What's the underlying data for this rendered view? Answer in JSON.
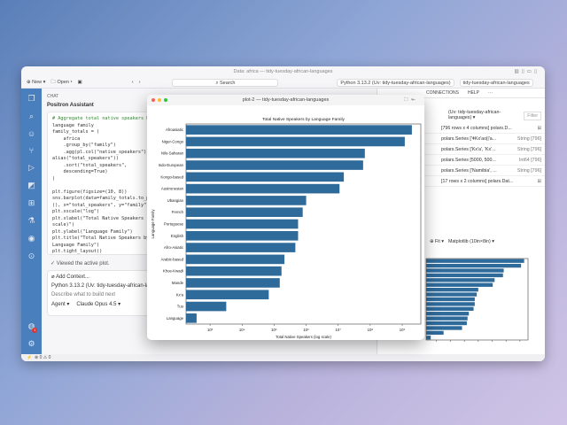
{
  "window": {
    "title": "Data: africa — tidy-tuesday-african-languages"
  },
  "toolbar": {
    "new": "New",
    "open": "Open",
    "search": "Search",
    "interpreter": "Python 3.13.2 (Uv: tidy-tuesday-african-languages)",
    "project": "tidy-tuesday-african-languages"
  },
  "chat": {
    "section": "CHAT",
    "assistant": "Positron Assistant",
    "code": [
      "# Aggregate total native speakers by",
      "language family",
      "family_totals = (",
      "    africa",
      "    .group_by(\"family\")",
      "    .agg(pl.col(\"native_speakers\").sum().",
      "alias(\"total_speakers\"))",
      "    .sort(\"total_speakers\",",
      "    descending=True)",
      ")",
      "",
      "plt.figure(figsize=(10, 8))",
      "sns.barplot(data=family_totals.to_pandas",
      "(), x=\"total_speakers\", y=\"family\")",
      "plt.xscale(\"log\")",
      "plt.xlabel(\"Total Native Speakers (log",
      "scale)\")",
      "plt.ylabel(\"Language Family\")",
      "plt.title(\"Total Native Speakers by",
      "Language Family\")",
      "plt.tight_layout()",
      "plt.show()"
    ],
    "viewed": "Viewed the active plot.",
    "add_context": "Add Context...",
    "session": "Python 3.13.2 (Uv: tidy-tuesday-african-languages)",
    "placeholder": "Describe what to build next",
    "mode": "Agent",
    "model": "Claude Opus 4.5",
    "badge_count": "1"
  },
  "right": {
    "tabs": [
      "CONNECTIONS",
      "HELP",
      "···"
    ],
    "session": "(Uv: tidy-tuesday-african-languages) ▾",
    "filter": "Filter",
    "vars": [
      {
        "v": "[796 rows x 4 columns] polars.D...",
        "t": ""
      },
      {
        "v": "polars.Series ['ǂKx'ao||'a...",
        "t": "String [796]"
      },
      {
        "v": "polars.Series ['Kx'a', 'Kx'...",
        "t": "String [796]"
      },
      {
        "v": "polars.Series [5000, 500...",
        "t": "Int64 [796]"
      },
      {
        "v": "polars.Series ['Namibia', ...",
        "t": "String [796]"
      },
      {
        "v": "[17 rows x 2 columns] polars.Dat...",
        "t": ""
      }
    ],
    "plot_tools": {
      "fit": "Fit",
      "size": "Matplotlib (10in×8in)"
    }
  },
  "status": {
    "errors": "0",
    "warnings": "0"
  },
  "plot_window": {
    "title": "plot-2 — tidy-tuesday-african-languages"
  },
  "chart_data": {
    "type": "bar",
    "orientation": "horizontal",
    "title": "Total Native Speakers by Language Family",
    "xlabel": "Total Native Speakers (log scale)",
    "ylabel": "Language Family",
    "xscale": "log",
    "xlim": [
      178,
      3800000000.0
    ],
    "xticks": [
      1000.0,
      10000.0,
      100000.0,
      1000000.0,
      10000000.0,
      100000000.0,
      1000000000.0
    ],
    "xtick_labels": [
      "10³",
      "10⁴",
      "10⁵",
      "10⁶",
      "10⁷",
      "10⁸",
      "10⁹"
    ],
    "categories": [
      "Afroasiatic",
      "Niger-Congo",
      "Nilo-Saharan",
      "Indo-European",
      "Kongo-based",
      "Austronesian",
      "Ubangian",
      "French",
      "Portuguese",
      "English",
      "Afro-Asiatic",
      "Arabic-based",
      "Khoe-Kwadi",
      "Mande",
      "Kx'a",
      "Tuu",
      "Language"
    ],
    "values": [
      2000000000.0,
      1200000000.0,
      68000000.0,
      60000000.0,
      15000000.0,
      11000000.0,
      1000000.0,
      780000.0,
      560000.0,
      560000.0,
      460000.0,
      210000.0,
      170000.0,
      150000.0,
      68000.0,
      3200.0,
      380
    ],
    "color": "#2e6a9a"
  }
}
